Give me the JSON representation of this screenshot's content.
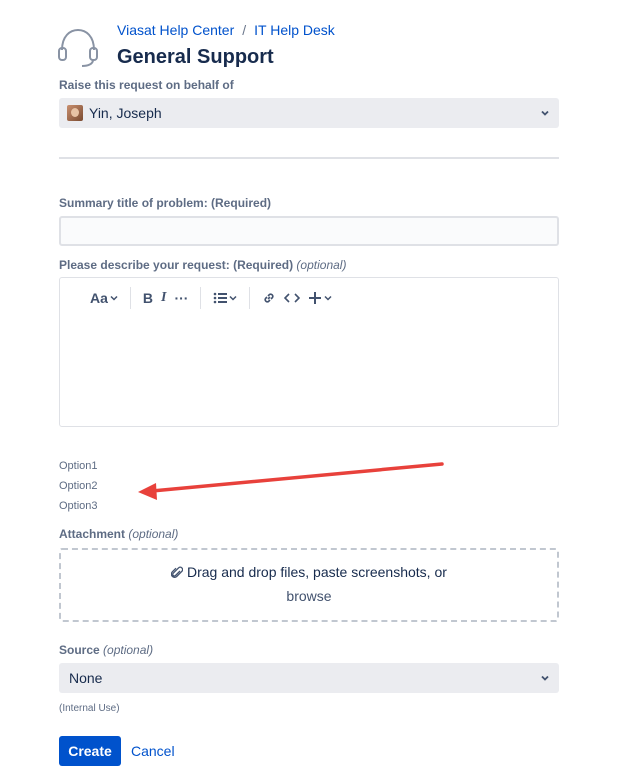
{
  "header": {
    "breadcrumb": [
      "Viasat Help Center",
      "/",
      "IT Help Desk"
    ],
    "title": "General Support",
    "logo_icon": "headset-icon"
  },
  "behalf": {
    "label": "Raise this request on behalf of",
    "value": "Yin, Joseph"
  },
  "summary": {
    "label": "Summary title of problem: (Required)",
    "value": ""
  },
  "description": {
    "label": "Please describe your request: (Required)",
    "optional": "(optional)",
    "toolbar": {
      "text_style": "Aa",
      "bold": "B",
      "italic": "I",
      "more": "···"
    }
  },
  "options": [
    "Option1",
    "Option2",
    "Option3"
  ],
  "attachment": {
    "label": "Attachment",
    "optional": "(optional)",
    "line1": "Drag and drop files, paste screenshots, or",
    "line2": "browse"
  },
  "source": {
    "label": "Source",
    "optional": "(optional)",
    "value": "None",
    "hint": "(Internal Use)"
  },
  "actions": {
    "create": "Create",
    "cancel": "Cancel"
  },
  "colors": {
    "primary": "#0052cc",
    "arrow": "#e8413b",
    "field_bg": "#ebecf0"
  }
}
